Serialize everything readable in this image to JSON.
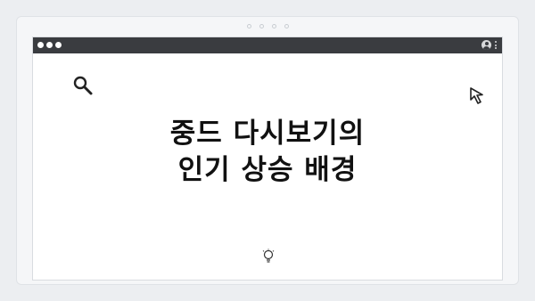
{
  "slide": {
    "title_line1": "중드 다시보기의",
    "title_line2": "인기 상승 배경"
  },
  "icons": {
    "search": "search-icon",
    "cursor": "cursor-arrow-icon",
    "bulb": "lightbulb-icon",
    "user": "user-icon",
    "menu": "more-vertical-icon"
  },
  "colors": {
    "titlebar": "#3a3c40",
    "background": "#eceef1",
    "window": "#ffffff",
    "text": "#111111"
  }
}
